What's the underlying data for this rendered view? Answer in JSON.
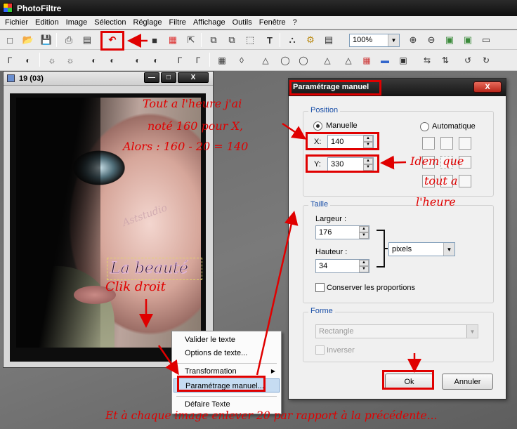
{
  "app": {
    "title": "PhotoFiltre"
  },
  "menu": [
    "Fichier",
    "Edition",
    "Image",
    "Sélection",
    "Réglage",
    "Filtre",
    "Affichage",
    "Outils",
    "Fenêtre",
    "?"
  ],
  "toolbar": {
    "zoom_value": "100%"
  },
  "image_window": {
    "title": "19 (03)",
    "watermark": "Aststudio",
    "selection_text": "La beauté"
  },
  "context_menu": {
    "items": [
      {
        "label": "Valider le texte"
      },
      {
        "label": "Options de texte..."
      },
      {
        "label": "Transformation"
      },
      {
        "label": "Paramétrage manuel..."
      },
      {
        "label": "Défaire Texte"
      }
    ],
    "highlighted": "Paramétrage manuel..."
  },
  "dialog": {
    "title": "Paramétrage manuel",
    "close": "X",
    "position": {
      "group_label": "Position",
      "manual_label": "Manuelle",
      "auto_label": "Automatique",
      "mode": "Manuelle",
      "x_label": "X:",
      "x_value": "140",
      "y_label": "Y:",
      "y_value": "330"
    },
    "size": {
      "group_label": "Taille",
      "width_label": "Largeur :",
      "width_value": "176",
      "height_label": "Hauteur :",
      "height_value": "34",
      "unit": "pixels",
      "keep_ratio_label": "Conserver les proportions",
      "keep_ratio_checked": false
    },
    "shape": {
      "group_label": "Forme",
      "shape_value": "Rectangle",
      "invert_label": "Inverser"
    },
    "ok_label": "Ok",
    "cancel_label": "Annuler"
  },
  "annotations": {
    "note1_line1": "Tout a l'heure j'ai",
    "note1_line2": "noté 160 pour X,",
    "note1_line3": "Alors : 160 - 20 = 140",
    "note2_line1": "Idem que",
    "note2_line2": "tout a",
    "note2_line3": "l'heure",
    "note3": "Clik droit",
    "note4": "Et à chaque image enlever 20 par rapport à la précédente...",
    "color": "#e00000"
  }
}
